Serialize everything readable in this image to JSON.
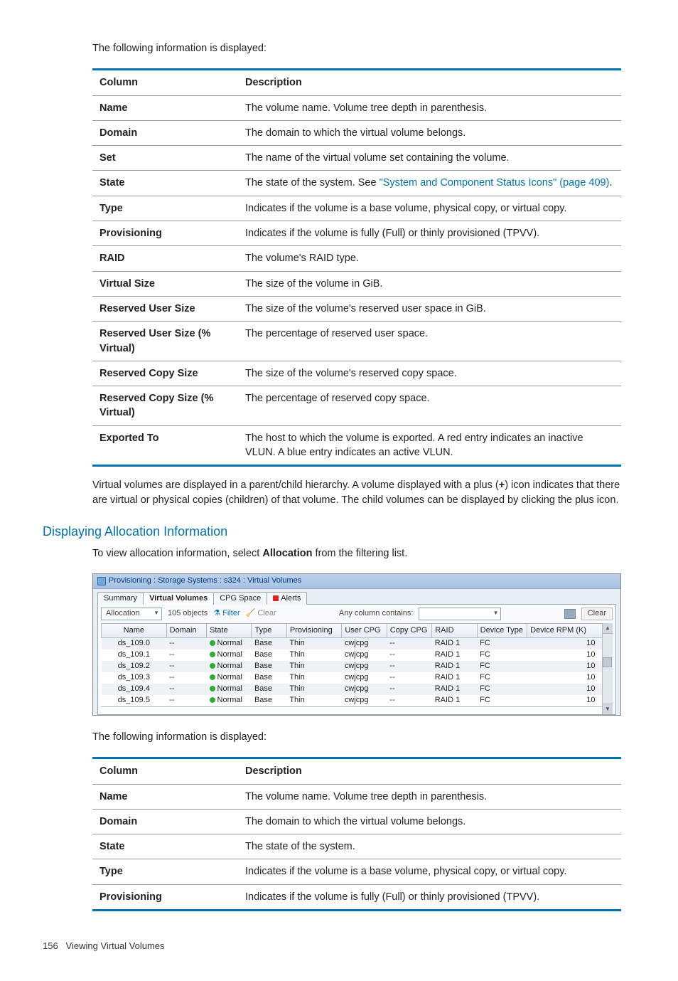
{
  "intro1": "The following information is displayed:",
  "table1": {
    "headers": [
      "Column",
      "Description"
    ],
    "rows": [
      {
        "c": "Name",
        "d": "The volume name. Volume tree depth in parenthesis."
      },
      {
        "c": "Domain",
        "d": "The domain to which the virtual volume belongs."
      },
      {
        "c": "Set",
        "d": "The name of the virtual volume set containing the volume."
      },
      {
        "c": "State",
        "d_pre": "The state of the system. See ",
        "link": "\"System and Component Status Icons\" (page 409)",
        "d_post": "."
      },
      {
        "c": "Type",
        "d": "Indicates if the volume is a base volume, physical copy, or virtual copy."
      },
      {
        "c": "Provisioning",
        "d": "Indicates if the volume is fully (Full) or thinly provisioned (TPVV)."
      },
      {
        "c": "RAID",
        "d": "The volume's RAID type."
      },
      {
        "c": "Virtual Size",
        "d": "The size of the volume in GiB."
      },
      {
        "c": "Reserved User Size",
        "d": "The size of the volume's reserved user space in GiB."
      },
      {
        "c": "Reserved User Size (% Virtual)",
        "d": "The percentage of reserved user space."
      },
      {
        "c": "Reserved Copy Size",
        "d": "The size of the volume's reserved copy space."
      },
      {
        "c": "Reserved Copy Size (% Virtual)",
        "d": "The percentage of reserved copy space."
      },
      {
        "c": "Exported To",
        "d": "The host to which the volume is exported. A red entry indicates an inactive VLUN. A blue entry indicates an active VLUN."
      }
    ]
  },
  "para_hierarchy_pre": "Virtual volumes are displayed in a parent/child hierarchy. A volume displayed with a plus (",
  "para_hierarchy_bold": "+",
  "para_hierarchy_post": ") icon indicates that there are virtual or physical copies (children) of that volume. The child volumes can be displayed by clicking the plus icon.",
  "section_heading": "Displaying Allocation Information",
  "alloc_intro_pre": "To view allocation information, select ",
  "alloc_intro_bold": "Allocation",
  "alloc_intro_post": " from the filtering list.",
  "shot": {
    "title": "Provisioning : Storage Systems : s324 : Virtual Volumes",
    "tabs": [
      "Summary",
      "Virtual Volumes",
      "CPG Space",
      "Alerts"
    ],
    "active_tab": 1,
    "toolbar": {
      "selector": "Allocation",
      "objects": "105 objects",
      "filter": "Filter",
      "clear1": "Clear",
      "anycol": "Any column contains:",
      "clear2": "Clear"
    },
    "headers": [
      "Name",
      "Domain",
      "State",
      "Type",
      "Provisioning",
      "User CPG",
      "Copy CPG",
      "RAID",
      "Device Type",
      "Device RPM (K)"
    ],
    "rows": [
      {
        "name": "ds_109.0",
        "domain": "--",
        "state": "Normal",
        "type": "Base",
        "prov": "Thin",
        "ucpg": "cwjcpg",
        "ccpg": "--",
        "raid": "RAID 1",
        "dt": "FC",
        "rpm": "10"
      },
      {
        "name": "ds_109.1",
        "domain": "--",
        "state": "Normal",
        "type": "Base",
        "prov": "Thin",
        "ucpg": "cwjcpg",
        "ccpg": "--",
        "raid": "RAID 1",
        "dt": "FC",
        "rpm": "10"
      },
      {
        "name": "ds_109.2",
        "domain": "--",
        "state": "Normal",
        "type": "Base",
        "prov": "Thin",
        "ucpg": "cwjcpg",
        "ccpg": "--",
        "raid": "RAID 1",
        "dt": "FC",
        "rpm": "10"
      },
      {
        "name": "ds_109.3",
        "domain": "--",
        "state": "Normal",
        "type": "Base",
        "prov": "Thin",
        "ucpg": "cwjcpg",
        "ccpg": "--",
        "raid": "RAID 1",
        "dt": "FC",
        "rpm": "10"
      },
      {
        "name": "ds_109.4",
        "domain": "--",
        "state": "Normal",
        "type": "Base",
        "prov": "Thin",
        "ucpg": "cwjcpg",
        "ccpg": "--",
        "raid": "RAID 1",
        "dt": "FC",
        "rpm": "10"
      },
      {
        "name": "ds_109.5",
        "domain": "--",
        "state": "Normal",
        "type": "Base",
        "prov": "Thin",
        "ucpg": "cwjcpg",
        "ccpg": "--",
        "raid": "RAID 1",
        "dt": "FC",
        "rpm": "10"
      }
    ]
  },
  "intro2": "The following information is displayed:",
  "table2": {
    "headers": [
      "Column",
      "Description"
    ],
    "rows": [
      {
        "c": "Name",
        "d": "The volume name. Volume tree depth in parenthesis."
      },
      {
        "c": "Domain",
        "d": "The domain to which the virtual volume belongs."
      },
      {
        "c": "State",
        "d": "The state of the system."
      },
      {
        "c": "Type",
        "d": "Indicates if the volume is a base volume, physical copy, or virtual copy."
      },
      {
        "c": "Provisioning",
        "d": "Indicates if the volume is fully (Full) or thinly provisioned (TPVV)."
      }
    ]
  },
  "footer_page": "156",
  "footer_text": "Viewing Virtual Volumes"
}
